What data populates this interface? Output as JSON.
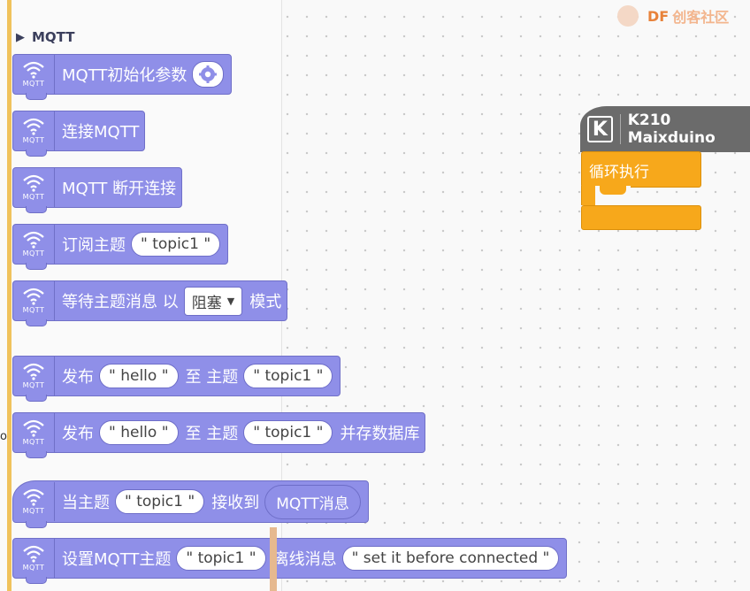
{
  "logo": {
    "brand": "DF",
    "site": "创客社区"
  },
  "flyout": {
    "category": "MQTT",
    "stray_text": "o",
    "blocks": {
      "init": {
        "label": "MQTT初始化参数"
      },
      "connect": {
        "label": "连接MQTT"
      },
      "disconnect": {
        "label": "MQTT 断开连接"
      },
      "subscribe": {
        "label": "订阅主题",
        "topic": "\" topic1 \""
      },
      "wait": {
        "label": "等待主题消息 以",
        "mode": "阻塞",
        "suffix": "模式"
      },
      "publish": {
        "label": "发布",
        "msg": "\" hello \"",
        "to": "至 主题",
        "topic": "\" topic1 \""
      },
      "publish_save": {
        "label": "发布",
        "msg": "\" hello \"",
        "to": "至 主题",
        "topic": "\" topic1 \"",
        "suffix": "并存数据库"
      },
      "on_receive": {
        "label": "当主题",
        "topic": "\" topic1 \"",
        "recv": "接收到",
        "reporter": "MQTT消息"
      },
      "lastwill": {
        "label": "设置MQTT主题",
        "topic": "\" topic1 \"",
        "offline": "离线消息",
        "msg": "\" set it before connected \""
      },
      "icon_caption": "MQTT"
    }
  },
  "workspace": {
    "hat": {
      "logo_letter": "K",
      "label": "K210 Maixduino"
    },
    "loop": {
      "label": "循环执行"
    }
  },
  "colors": {
    "mqtt_block": "#8f8fe8",
    "loop": "#f7a81b",
    "hat": "#6b6b6b"
  }
}
